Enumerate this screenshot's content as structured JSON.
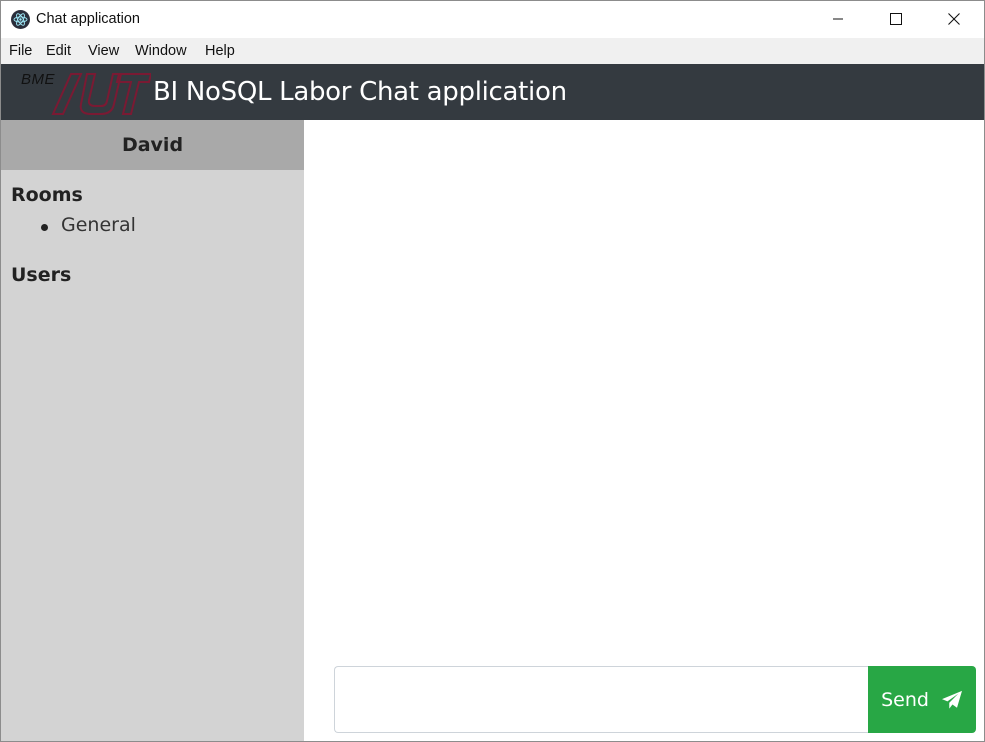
{
  "window": {
    "title": "Chat application",
    "app_icon": "electron-icon",
    "controls": [
      "minimize-icon",
      "maximize-icon",
      "close-icon"
    ]
  },
  "menu": {
    "items": [
      "File",
      "Edit",
      "View",
      "Window",
      "Help"
    ]
  },
  "header": {
    "logo_text": "BME",
    "logo_mark": "/UT",
    "title": "BI NoSQL Labor Chat application"
  },
  "sidebar": {
    "current_user": "David",
    "rooms_title": "Rooms",
    "rooms": [
      "General"
    ],
    "users_title": "Users",
    "users": []
  },
  "chat": {
    "messages": [],
    "input_value": "",
    "input_placeholder": "",
    "send_label": "Send",
    "send_icon": "paper-plane-icon"
  },
  "colors": {
    "header_bg": "#343a40",
    "sidebar_bg": "#d3d3d3",
    "user_header_bg": "#a9a9a9",
    "send_button": "#28a745",
    "logo_red": "#7a1a33"
  }
}
